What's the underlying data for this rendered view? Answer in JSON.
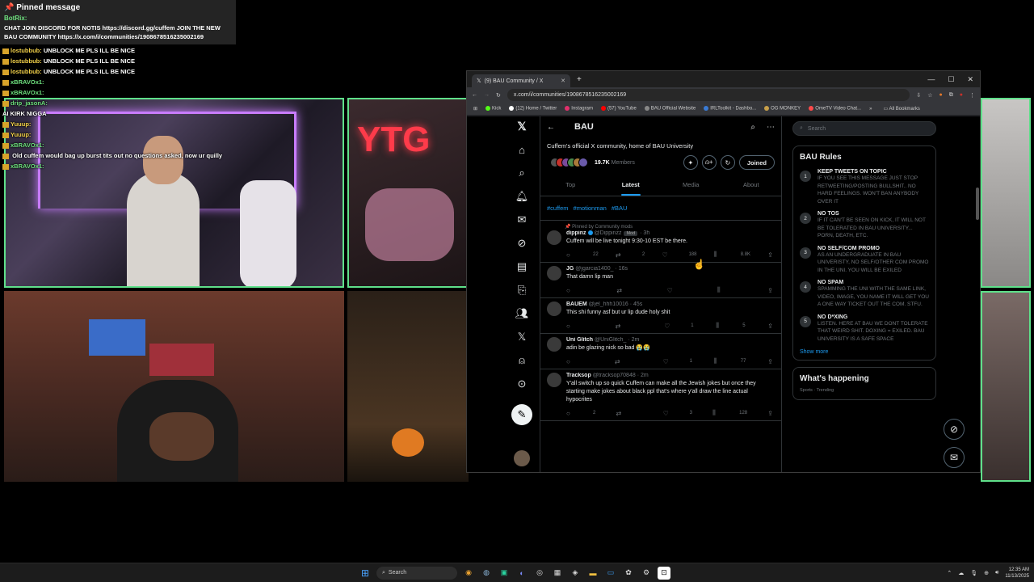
{
  "chat": {
    "pinned_title": "Pinned message",
    "pinned_user": "BotRix:",
    "pinned_text": "CHAT JOIN DISCORD FOR NOTIS https://discord.gg/cuffem JOIN THE NEW BAU COMMUNITY https://x.com/i/communities/1908678516235002169",
    "messages": [
      {
        "user": "lostubbub:",
        "text": "UNBLOCK ME PLS ILL BE NICE"
      },
      {
        "user": "lostubbub:",
        "text": "UNBLOCK ME PLS ILL BE NICE"
      },
      {
        "user": "lostubbub:",
        "text": "UNBLOCK ME PLS ILL BE NICE"
      },
      {
        "user": "xBRAVOx1:",
        "text": ""
      },
      {
        "user": "xBRAVOx1:",
        "text": ""
      },
      {
        "user": "drip_jasonA:",
        "text": ""
      },
      {
        "user": "",
        "text": "AI KIRK NIGGA"
      },
      {
        "user": "Yuuup:",
        "text": ""
      },
      {
        "user": "Yuuup:",
        "text": ""
      },
      {
        "user": "xBRAVOx1:",
        "text": ""
      },
      {
        "user": "",
        "text": "Old cuffem would bag up burst tits out no questions asked, now ur quilly"
      },
      {
        "user": "xBRAVOx1:",
        "text": ""
      }
    ]
  },
  "browser": {
    "tab_title": "(9) BAU Community / X",
    "url": "x.com/i/communities/1908678516235002169",
    "bookmarks": [
      "Kick",
      "(12) Home / Twitter",
      "Instagram",
      "(57) YouTube",
      "BAU Official Website",
      "IRLToolkit - Dashbo...",
      "OG MONKEY",
      "OmeTV Video Chat..."
    ],
    "all_bookmarks": "All Bookmarks"
  },
  "community": {
    "title": "BAU",
    "description": "Cuffem's official X community, home of BAU University",
    "members_count": "19.7K",
    "members_label": "Members",
    "joined_label": "Joined",
    "tabs": [
      "Top",
      "Latest",
      "Media",
      "About"
    ],
    "hashtags": [
      "#cuffem",
      "#motionman",
      "#BAU"
    ]
  },
  "posts": [
    {
      "pinned": "Pinned by Community mods",
      "name": "dippinz",
      "handle": "@Dippinzz",
      "mod": "Mod",
      "time": "· 3h",
      "text": "Cuffem will be live tonight 9:30-10 EST be there.",
      "replies": "22",
      "reposts": "2",
      "likes": "188",
      "views": "8.8K"
    },
    {
      "pinned": "",
      "name": "JG",
      "handle": "@jgarcia1400_",
      "mod": "",
      "time": "· 16s",
      "text": "That damn lip man",
      "replies": "",
      "reposts": "",
      "likes": "",
      "views": ""
    },
    {
      "pinned": "",
      "name": "BAUEM",
      "handle": "@jel_hhh10016",
      "mod": "",
      "time": "· 45s",
      "text": "This shi funny asf but ur lip dude holy shit",
      "replies": "",
      "reposts": "",
      "likes": "1",
      "views": "5"
    },
    {
      "pinned": "",
      "name": "Uni Glitch",
      "handle": "@UniGlitch_",
      "mod": "",
      "time": "· 2m",
      "text": "adin be glazing nick so bad 😭😭",
      "replies": "",
      "reposts": "",
      "likes": "1",
      "views": "77"
    },
    {
      "pinned": "",
      "name": "Tracksop",
      "handle": "@tracksop70848",
      "mod": "",
      "time": "· 2m",
      "text": "Y'all switch up so quick Cuffem can make all the Jewish jokes but once they starting make jokes about black ppl that's where y'all draw  the line actual hypocrites",
      "replies": "2",
      "reposts": "",
      "likes": "3",
      "views": "128"
    }
  ],
  "sidebar": {
    "search_placeholder": "Search",
    "rules_title": "BAU Rules",
    "rules": [
      {
        "num": "1",
        "title": "KEEP TWEETS ON TOPIC",
        "desc": "IF YOU SEE THIS MESSAGE JUST STOP RETWEETING/POSTING BULLSHIT.. NO HARD FEELINGS. WON'T BAN ANYBODY OVER IT"
      },
      {
        "num": "2",
        "title": "NO TOS",
        "desc": "IF IT CAN'T BE SEEN ON KICK, IT WILL NOT BE TOLERATED IN BAU UNIVERSITY... PORN, DEATH, ETC."
      },
      {
        "num": "3",
        "title": "NO SELF/COM PROMO",
        "desc": "AS AN UNDERGRADUATE IN BAU UNIVERISTY, NO SELF/OTHER COM PROMO IN THE UNI. YOU WILL BE EXILED"
      },
      {
        "num": "4",
        "title": "NO SPAM",
        "desc": "SPAMMING THE UNI WITH THE SAME LINK, VIDEO, IMAGE, YOU NAME IT WILL GET YOU A ONE WAY TICKET OUT THE COM. STFU."
      },
      {
        "num": "5",
        "title": "NO D*XING",
        "desc": "LISTEN. HERE AT BAU WE DONT TOLERATE THAT WEIRD SHIT. DOXING = EXILED. BAU UNIVERSITY IS A SAFE SPACE"
      }
    ],
    "show_more": "Show more",
    "happening_title": "What's happening",
    "happening_sub": "Sports · Trending"
  },
  "taskbar": {
    "search": "Search",
    "time": "12:35 AM",
    "date": "11/13/2025"
  },
  "colors": {
    "accent": "#1d9bf0",
    "cam_border": "#5fe08a",
    "x_bg": "#000000"
  }
}
